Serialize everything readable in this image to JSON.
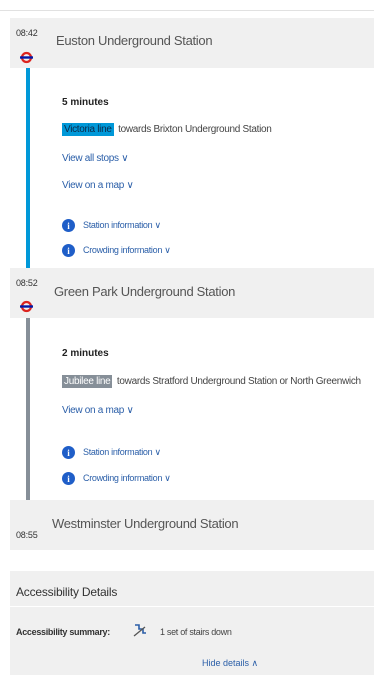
{
  "journey": {
    "stops": [
      {
        "time": "08:42",
        "name": "Euston Underground Station"
      },
      {
        "time": "08:52",
        "name": "Green Park Underground Station"
      },
      {
        "time": "08:55",
        "name": "Westminster Underground Station"
      }
    ],
    "legs": [
      {
        "duration": "5 minutes",
        "line": "Victoria line",
        "direction": "towards Brixton Underground Station",
        "line_color": "#0098d8",
        "view_stops": "View all stops ∨",
        "view_map": "View on a map ∨",
        "station_info": "Station information ∨",
        "crowding_info": "Crowding information ∨"
      },
      {
        "duration": "2 minutes",
        "line": "Jubilee line",
        "direction": "towards Stratford Underground Station or North Greenwich",
        "line_color": "#868f98",
        "view_map": "View on a map ∨",
        "station_info": "Station information ∨",
        "crowding_info": "Crowding information ∨"
      }
    ]
  },
  "accessibility": {
    "title": "Accessibility Details",
    "summary_label": "Accessibility summary:",
    "summary_value": "1 set of stairs down",
    "hide_details": "Hide details  ∧"
  },
  "icons": {
    "station_marker": "underground-roundel-icon",
    "info": "info-icon",
    "stairs": "stairs-down-icon"
  },
  "colors": {
    "roundel_red": "#dc241f",
    "roundel_blue": "#0019a8",
    "link_blue": "#2a5ea8",
    "panel_grey": "#f0f0f0"
  }
}
